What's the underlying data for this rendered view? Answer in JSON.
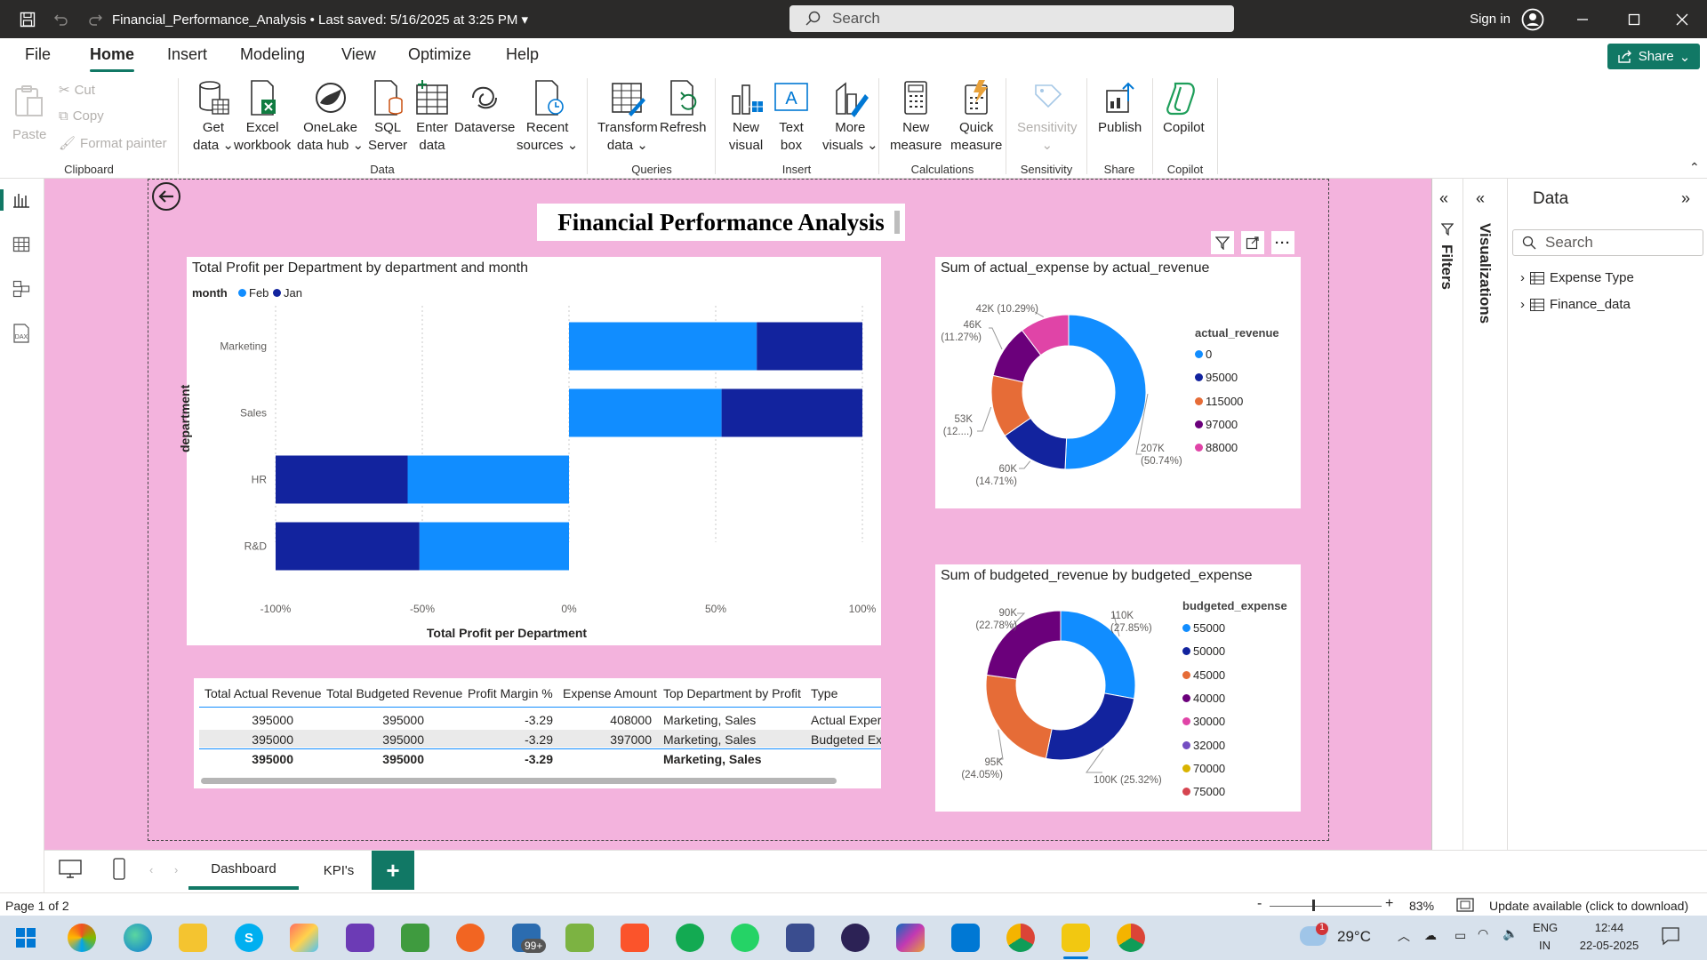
{
  "window": {
    "title": "Financial_Performance_Analysis",
    "saved": " • Last saved: 5/16/2025 at 3:25 PM",
    "search_placeholder": "Search",
    "sign_in": "Sign in"
  },
  "menu": [
    "File",
    "Home",
    "Insert",
    "Modeling",
    "View",
    "Optimize",
    "Help"
  ],
  "share_label": "Share",
  "ribbon": {
    "paste": "Paste",
    "cut": "Cut",
    "copy": "Copy",
    "format_painter": "Format painter",
    "buttons": [
      {
        "l1": "Get",
        "l2": "data ⌄"
      },
      {
        "l1": "Excel",
        "l2": "workbook"
      },
      {
        "l1": "OneLake",
        "l2": "data hub ⌄"
      },
      {
        "l1": "SQL",
        "l2": "Server"
      },
      {
        "l1": "Enter",
        "l2": "data"
      },
      {
        "l1": "Dataverse",
        "l2": ""
      },
      {
        "l1": "Recent",
        "l2": "sources ⌄"
      },
      {
        "l1": "Transform",
        "l2": "data ⌄"
      },
      {
        "l1": "Refresh",
        "l2": ""
      },
      {
        "l1": "New",
        "l2": "visual"
      },
      {
        "l1": "Text",
        "l2": "box"
      },
      {
        "l1": "More",
        "l2": "visuals ⌄"
      },
      {
        "l1": "New",
        "l2": "measure"
      },
      {
        "l1": "Quick",
        "l2": "measure"
      },
      {
        "l1": "Sensitivity",
        "l2": "⌄"
      },
      {
        "l1": "Publish",
        "l2": ""
      },
      {
        "l1": "Copilot",
        "l2": ""
      }
    ],
    "groups": [
      "Clipboard",
      "Data",
      "Queries",
      "Insert",
      "Calculations",
      "Sensitivity",
      "Share",
      "Copilot"
    ]
  },
  "report_title": "Financial Performance Analysis",
  "bar_chart": {
    "title": "Total Profit per Department by department and month",
    "legend_title": "month",
    "legend": [
      "Feb",
      "Jan"
    ],
    "ylabel": "department",
    "xlabel": "Total Profit per Department",
    "ticks": [
      "-100%",
      "-50%",
      "0%",
      "50%",
      "100%"
    ]
  },
  "chart_data": [
    {
      "type": "bar",
      "orientation": "horizontal",
      "stacked": "100%",
      "categories": [
        "Marketing",
        "Sales",
        "HR",
        "R&D"
      ],
      "series": [
        {
          "name": "Feb",
          "values": [
            64,
            52,
            -55,
            -51
          ]
        },
        {
          "name": "Jan",
          "values": [
            36,
            48,
            -45,
            -49
          ]
        }
      ],
      "xlim": [
        -100,
        100
      ],
      "xlabel": "Total Profit per Department",
      "ylabel": "department",
      "title": "Total Profit per Department by department and month"
    },
    {
      "type": "pie",
      "donut": true,
      "title": "Sum of actual_expense by actual_revenue",
      "legend_title": "actual_revenue",
      "labels": [
        "0",
        "95000",
        "115000",
        "97000",
        "88000"
      ],
      "values": [
        207,
        60,
        53,
        46,
        42
      ],
      "data_labels": [
        [
          "207K",
          "(50.74%)"
        ],
        [
          "60K",
          "(14.71%)"
        ],
        [
          "53K",
          "(12....)"
        ],
        [
          "46K",
          "(11.27%)"
        ],
        [
          "42K (10.29%)",
          ""
        ]
      ],
      "colors": [
        "#118dff",
        "#12239e",
        "#e66c37",
        "#6b007b",
        "#e044a7"
      ]
    },
    {
      "type": "pie",
      "donut": true,
      "title": "Sum of budgeted_revenue by budgeted_expense",
      "legend_title": "budgeted_expense",
      "labels": [
        "55000",
        "50000",
        "45000",
        "40000",
        "30000",
        "32000",
        "70000",
        "75000"
      ],
      "values": [
        110,
        100,
        95,
        90,
        0,
        0,
        0,
        0
      ],
      "data_labels": [
        [
          "110K",
          "(27.85%)"
        ],
        [
          "100K (25.32%)",
          ""
        ],
        [
          "95K",
          "(24.05%)"
        ],
        [
          "90K",
          "(22.78%)"
        ]
      ],
      "colors": [
        "#118dff",
        "#12239e",
        "#e66c37",
        "#6b007b",
        "#e044a7",
        "#744ec2",
        "#d9b300",
        "#d64550"
      ]
    }
  ],
  "table": {
    "headers": [
      "Total Actual Revenue",
      "Total Budgeted Revenue",
      "Profit Margin %",
      "Expense Amount",
      "Top Department by Profit",
      "Type"
    ],
    "rows": [
      [
        "395000",
        "395000",
        "-3.29",
        "408000",
        "Marketing, Sales",
        "Actual Exper"
      ],
      [
        "395000",
        "395000",
        "-3.29",
        "397000",
        "Marketing, Sales",
        "Budgeted Ex"
      ]
    ],
    "total": [
      "395000",
      "395000",
      "-3.29",
      "",
      "Marketing, Sales",
      ""
    ]
  },
  "panes": {
    "filters": "Filters",
    "visualizations": "Visualizations",
    "data_title": "Data",
    "data_search": "Search",
    "tables": [
      "Expense Type",
      "Finance_data"
    ]
  },
  "tabs": [
    "Dashboard",
    "KPI's"
  ],
  "status": {
    "page": "Page 1 of 2",
    "zoom": "83%",
    "update": "Update available (click to download)"
  },
  "taskbar": {
    "temp": "29°C",
    "lang1": "ENG",
    "lang2": "IN",
    "time": "12:44",
    "date": "22-05-2025",
    "badge": "99+",
    "weather_badge": "1"
  }
}
